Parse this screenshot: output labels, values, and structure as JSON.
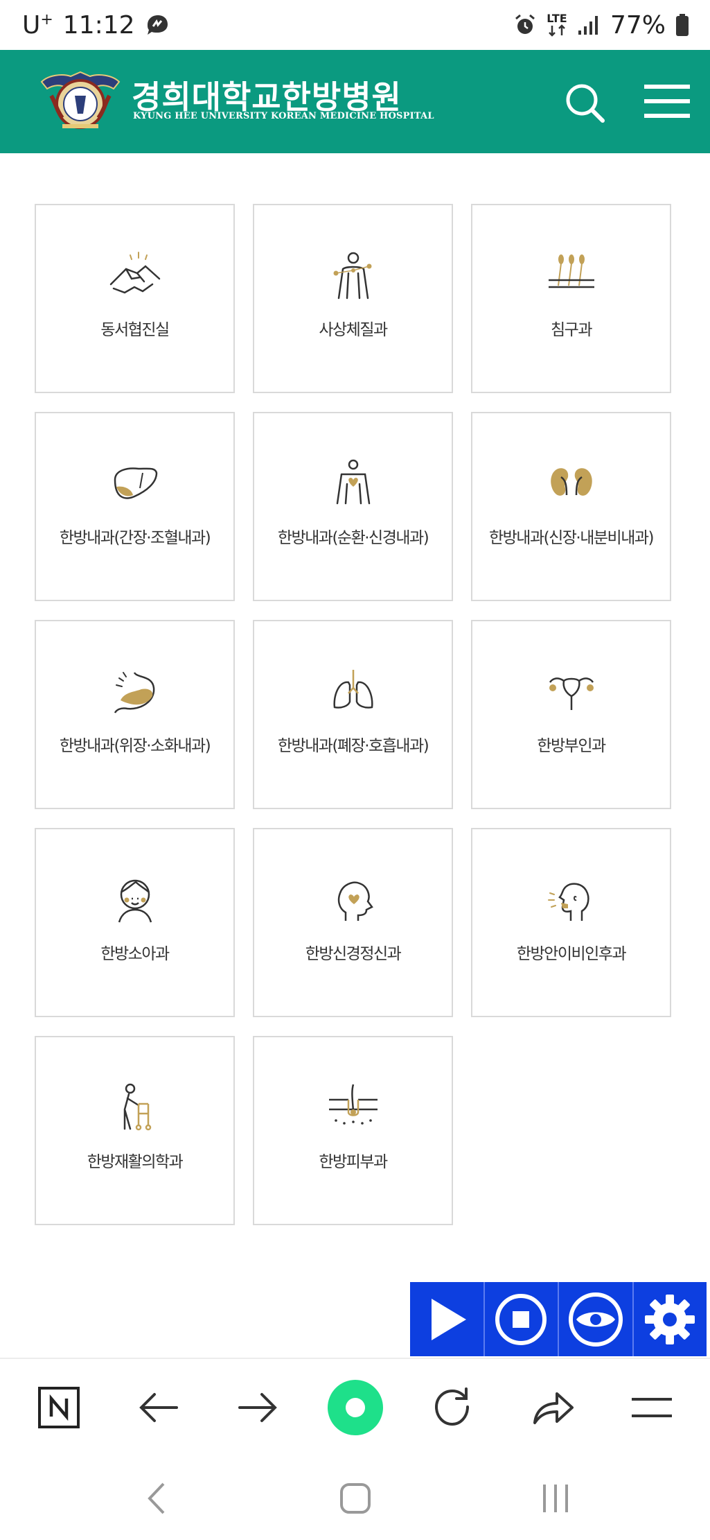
{
  "status_bar": {
    "carrier": "U",
    "carrier_sup": "+",
    "time": "11:12",
    "network": "LTE",
    "battery": "77%"
  },
  "header": {
    "title_ko": "경희대학교한방병원",
    "title_en": "KYUNG HEE UNIVERSITY KOREAN MEDICINE HOSPITAL"
  },
  "departments": [
    {
      "label": "동서협진실",
      "icon": "handshake-icon"
    },
    {
      "label": "사상체질과",
      "icon": "body-meridian-icon"
    },
    {
      "label": "침구과",
      "icon": "acupuncture-needles-icon"
    },
    {
      "label": "한방내과(간장·조혈내과)",
      "icon": "liver-icon"
    },
    {
      "label": "한방내과(순환·신경내과)",
      "icon": "heart-torso-icon"
    },
    {
      "label": "한방내과(신장·내분비내과)",
      "icon": "kidney-icon"
    },
    {
      "label": "한방내과(위장·소화내과)",
      "icon": "stomach-icon"
    },
    {
      "label": "한방내과(폐장·호흡내과)",
      "icon": "lungs-icon"
    },
    {
      "label": "한방부인과",
      "icon": "uterus-icon"
    },
    {
      "label": "한방소아과",
      "icon": "child-face-icon"
    },
    {
      "label": "한방신경정신과",
      "icon": "head-heart-icon"
    },
    {
      "label": "한방안이비인후과",
      "icon": "head-profile-icon"
    },
    {
      "label": "한방재활의학과",
      "icon": "walker-icon"
    },
    {
      "label": "한방피부과",
      "icon": "skin-hair-icon"
    }
  ],
  "colors": {
    "header_bg": "#0b9a80",
    "accent_gold": "#c2a157",
    "tts_blue": "#0d3fe0",
    "browser_green": "#1ee08a"
  },
  "browser_toolbar": [
    "naver-n-icon",
    "back-arrow-icon",
    "forward-arrow-icon",
    "green-dot-icon",
    "refresh-icon",
    "share-icon",
    "menu-lines-icon"
  ],
  "tts_toolbar": [
    "play-icon",
    "stop-icon",
    "eye-icon",
    "gear-icon"
  ]
}
